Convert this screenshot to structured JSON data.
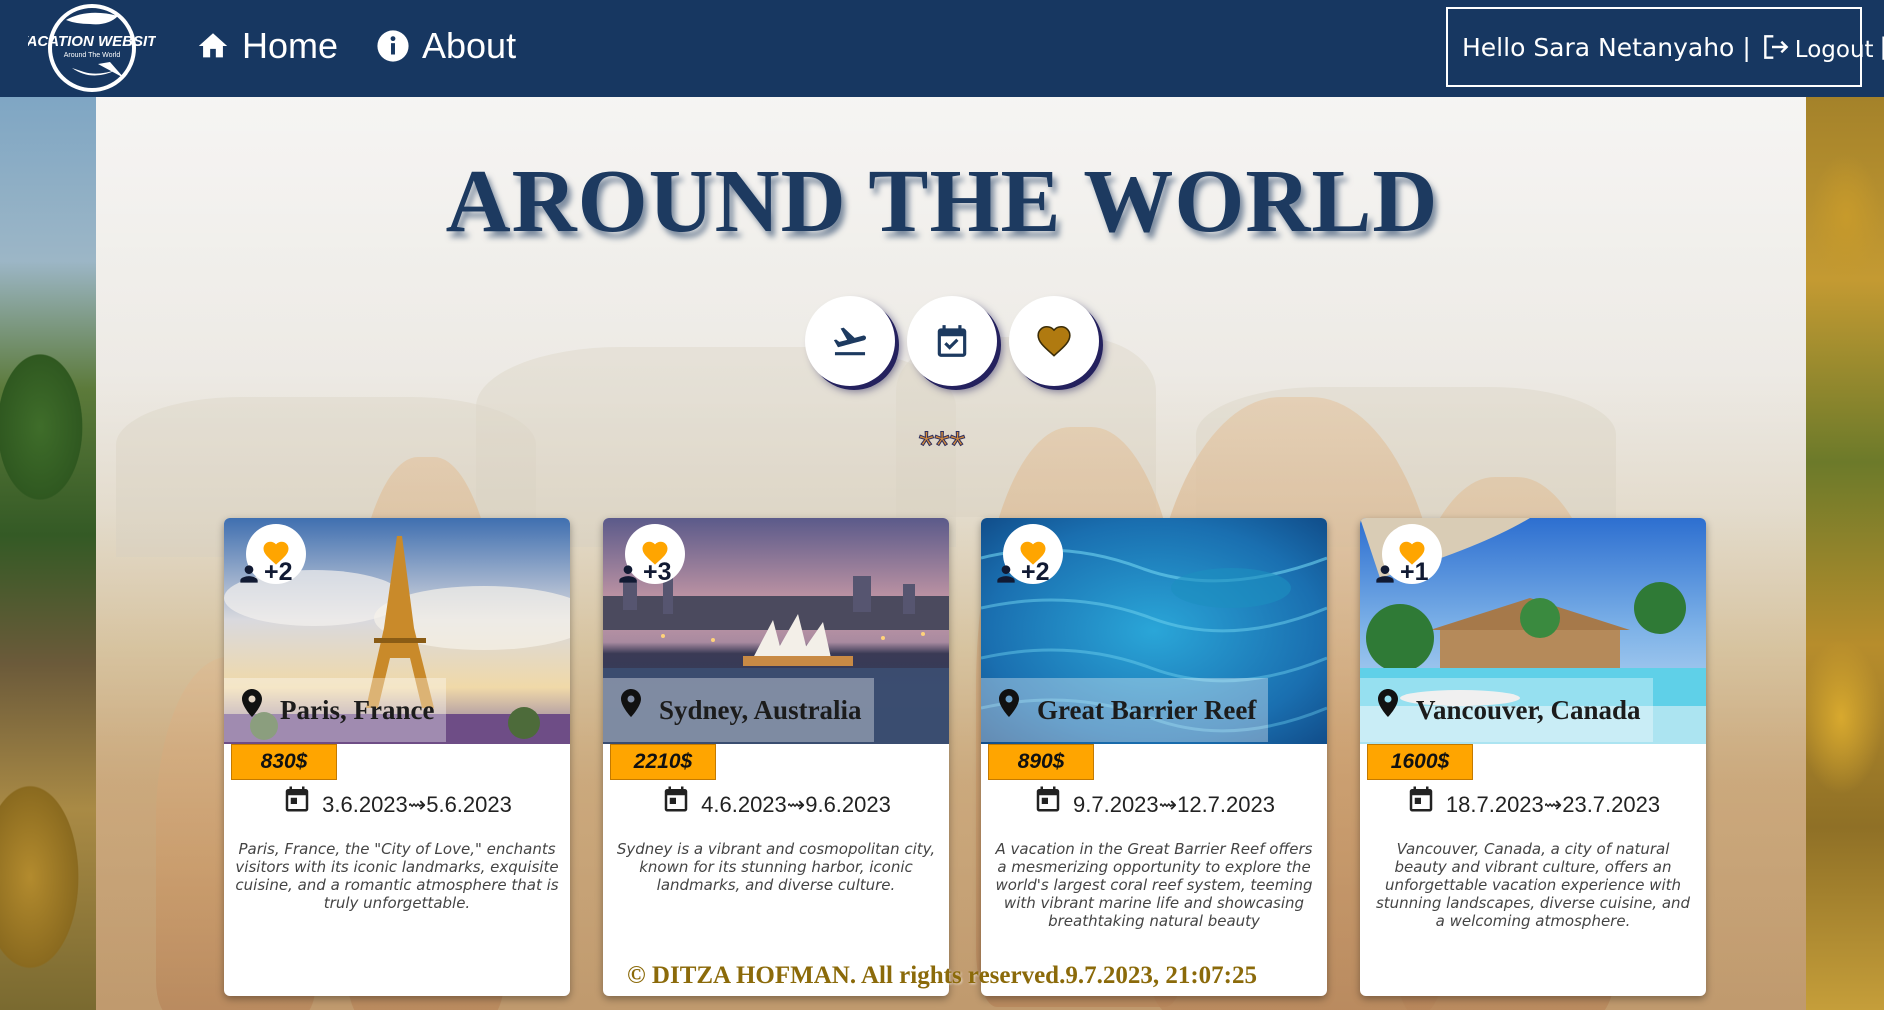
{
  "navbar": {
    "logo": {
      "title": "VACATION WEBSITE",
      "subtitle": "Around The World"
    },
    "home_label": "Home",
    "about_label": "About",
    "greeting": "Hello Sara Netanyaho",
    "separator": "|",
    "logout_label": "Logout",
    "logout_separator": "|"
  },
  "hero": {
    "title": "AROUND THE WORLD",
    "stars": "***"
  },
  "filters": [
    {
      "icon": "flight-takeoff-icon"
    },
    {
      "icon": "calendar-check-icon"
    },
    {
      "icon": "heart-filter-icon"
    }
  ],
  "colors": {
    "navbar": "#173761",
    "title": "#1d3a60",
    "price_badge": "#ffa500",
    "heart": "#ffa500",
    "footer": "#8b6a0a"
  },
  "vacations": [
    {
      "likes": "+2",
      "destination": "Paris, France",
      "price": "830$",
      "start": "3.6.2023",
      "arrow": "⇝",
      "end": "5.6.2023",
      "description": "Paris, France, the \"City of Love,\" enchants visitors with its iconic landmarks, exquisite cuisine, and a romantic atmosphere that is truly unforgettable."
    },
    {
      "likes": "+3",
      "destination": "Sydney, Australia",
      "price": "2210$",
      "start": "4.6.2023",
      "arrow": "⇝",
      "end": "9.6.2023",
      "description": "Sydney is a vibrant and cosmopolitan city, known for its stunning harbor, iconic landmarks, and diverse culture."
    },
    {
      "likes": "+2",
      "destination": "Great Barrier Reef",
      "price": "890$",
      "start": "9.7.2023",
      "arrow": "⇝",
      "end": "12.7.2023",
      "description": "A vacation in the Great Barrier Reef offers a mesmerizing opportunity to explore the world's largest coral reef system, teeming with vibrant marine life and showcasing breathtaking natural beauty"
    },
    {
      "likes": "+1",
      "destination": "Vancouver, Canada",
      "price": "1600$",
      "start": "18.7.2023",
      "arrow": "⇝",
      "end": "23.7.2023",
      "description": "Vancouver, Canada, a city of natural beauty and vibrant culture, offers an unforgettable vacation experience with stunning landscapes, diverse cuisine, and a welcoming atmosphere."
    }
  ],
  "footer": {
    "text": "© DITZA HOFMAN. All rights reserved.9.7.2023, 21:07:25"
  }
}
